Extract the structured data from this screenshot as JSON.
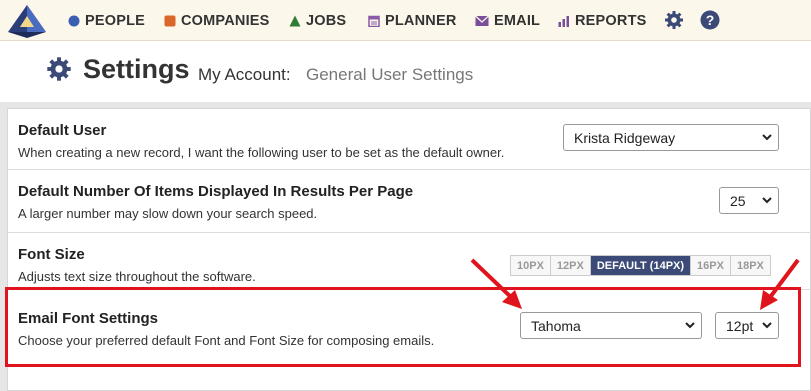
{
  "nav": {
    "items": [
      {
        "label": "PEOPLE",
        "icon": "person-icon",
        "color": "#3a5fb0"
      },
      {
        "label": "COMPANIES",
        "icon": "building-icon",
        "color": "#d9672a"
      },
      {
        "label": "JOBS",
        "icon": "triangle-icon",
        "color": "#2f7d35"
      },
      {
        "label": "PLANNER",
        "icon": "calendar-icon",
        "color": "#8a5aa8"
      },
      {
        "label": "EMAIL",
        "icon": "envelope-icon",
        "color": "#7a4f9a"
      },
      {
        "label": "REPORTS",
        "icon": "bar-chart-icon",
        "color": "#7a4f9a"
      }
    ],
    "settings_icon": "gear-icon",
    "help_icon": "question-icon",
    "accent": "#3c4a78"
  },
  "header": {
    "title": "Settings",
    "crumb_account": "My Account:",
    "crumb_page": "General User Settings"
  },
  "settings": {
    "default_user": {
      "title": "Default User",
      "desc": "When creating a new record, I want the following user to be set as the default owner.",
      "value": "Krista Ridgeway"
    },
    "results_per_page": {
      "title": "Default Number Of Items Displayed In Results Per Page",
      "desc": "A larger number may slow down your search speed.",
      "value": "25"
    },
    "font_size": {
      "title": "Font Size",
      "desc": "Adjusts text size throughout the software.",
      "options": [
        "10PX",
        "12PX",
        "DEFAULT (14PX)",
        "16PX",
        "18PX"
      ],
      "selected": "DEFAULT (14PX)"
    },
    "email_font": {
      "title": "Email Font Settings",
      "desc": "Choose your preferred default Font and Font Size for composing emails.",
      "font_value": "Tahoma",
      "size_value": "12pt"
    }
  },
  "annotation_color": "#e0141c"
}
